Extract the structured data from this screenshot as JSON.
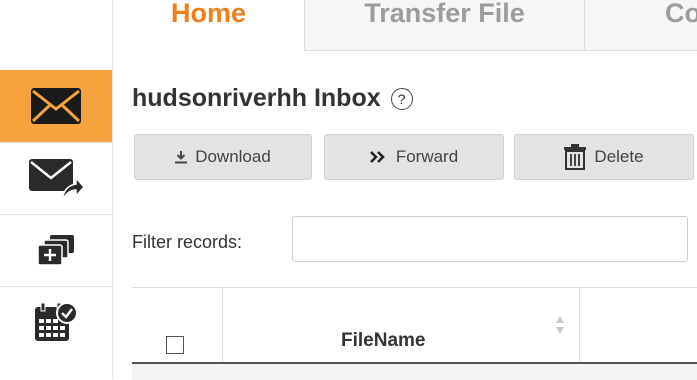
{
  "tabs": [
    {
      "label": "Home"
    },
    {
      "label": "Transfer File"
    },
    {
      "label": "Co"
    }
  ],
  "inbox": {
    "title": "hudsonriverhh Inbox",
    "help_glyph": "?"
  },
  "toolbar": {
    "download_label": "Download",
    "forward_label": "Forward",
    "delete_label": "Delete"
  },
  "filter": {
    "label": "Filter records:",
    "value": ""
  },
  "table": {
    "columns": [
      "FileName"
    ]
  },
  "sidebar": {
    "items": [
      {
        "icon": "inbox-envelope-icon",
        "active": true
      },
      {
        "icon": "sent-envelope-icon",
        "active": false
      },
      {
        "icon": "new-folder-icon",
        "active": false
      },
      {
        "icon": "schedule-calendar-icon",
        "active": false
      }
    ]
  },
  "colors": {
    "accent": "#ef7f1a",
    "active_rail": "#f4a33e",
    "button_bg": "#e3e3e3"
  }
}
